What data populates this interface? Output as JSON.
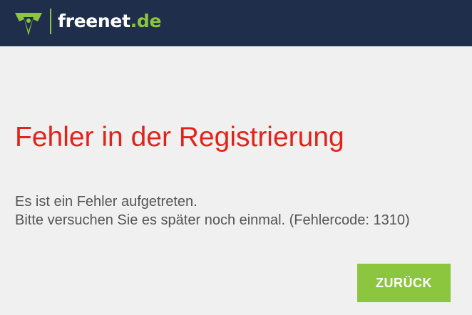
{
  "header": {
    "logo_icon": "freenet-logo-icon",
    "brand_name": "freenet",
    "brand_tld": ".de"
  },
  "error": {
    "title": "Fehler in der Registrierung",
    "line1": "Es ist ein Fehler aufgetreten.",
    "line2": "Bitte versuchen Sie es später noch einmal. (Fehlercode: 1310)"
  },
  "actions": {
    "back_label": "ZURÜCK"
  },
  "colors": {
    "header_bg": "#1f2e4a",
    "accent_green": "#8cc63f",
    "error_red": "#e2231a",
    "text_gray": "#555555",
    "page_bg": "#f0f0f0"
  }
}
